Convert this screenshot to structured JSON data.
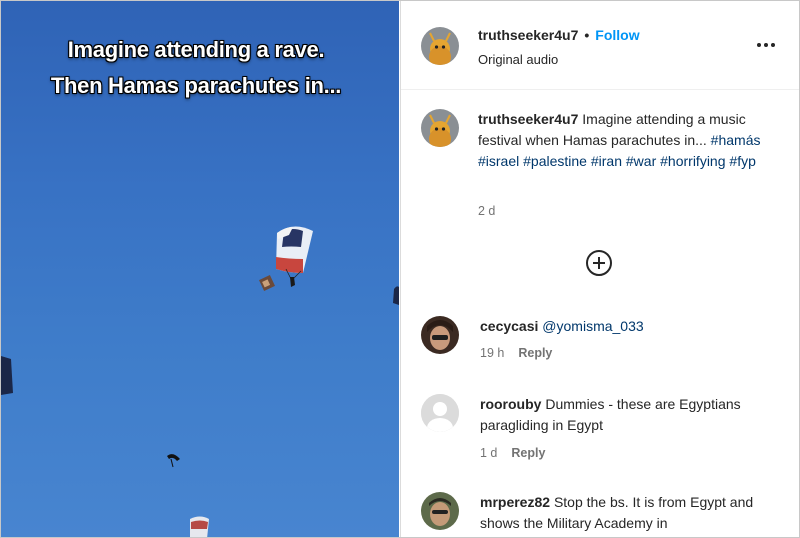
{
  "video": {
    "caption_line1": "Imagine attending a rave.",
    "caption_line2": "Then Hamas parachutes in..."
  },
  "header": {
    "username": "truthseeker4u7",
    "separator": "•",
    "follow_label": "Follow",
    "audio_label": "Original audio",
    "more_icon": "more-horizontal-icon"
  },
  "post": {
    "username": "truthseeker4u7",
    "text": "Imagine attending a music festival when Hamas parachutes in...",
    "hashtags": [
      "#hamás",
      "#israel",
      "#palestine",
      "#iran",
      "#war",
      "#horrifying",
      "#fyp"
    ],
    "time": "2 d",
    "add_icon": "add-circle-icon"
  },
  "comments": [
    {
      "username": "cecycasi",
      "text": "@yomisma_033",
      "time": "19 h",
      "reply_label": "Reply"
    },
    {
      "username": "roorouby",
      "text": "Dummies - these are Egyptians paragliding in Egypt",
      "time": "1 d",
      "reply_label": "Reply"
    },
    {
      "username": "mrperez82",
      "text": "Stop the bs. It is from Egypt and shows the Military Academy in",
      "time": "",
      "reply_label": ""
    }
  ],
  "colors": {
    "follow": "#0095f6",
    "hashtag": "#00376b",
    "sky": "#3872c4",
    "muted": "#737373"
  }
}
